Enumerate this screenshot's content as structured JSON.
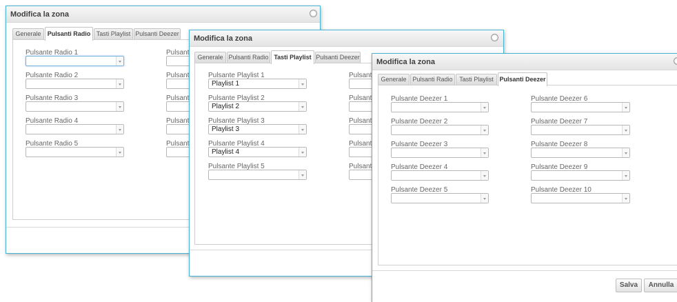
{
  "dialogs": [
    {
      "title": "Modifica la zona",
      "tabs": [
        "Generale",
        "Pulsanti Radio",
        "Tasti Playlist",
        "Pulsanti Deezer"
      ],
      "active_tab": 1,
      "left_fields": [
        {
          "label": "Pulsante Radio 1",
          "value": ""
        },
        {
          "label": "Pulsante Radio 2",
          "value": ""
        },
        {
          "label": "Pulsante Radio 3",
          "value": ""
        },
        {
          "label": "Pulsante Radio 4",
          "value": ""
        },
        {
          "label": "Pulsante Radio 5",
          "value": ""
        }
      ],
      "right_partial_label": "Pulsante"
    },
    {
      "title": "Modifica la zona",
      "tabs": [
        "Generale",
        "Pulsanti Radio",
        "Tasti Playlist",
        "Pulsanti Deezer"
      ],
      "active_tab": 2,
      "left_fields": [
        {
          "label": "Pulsante Playlist 1",
          "value": "Playlist 1"
        },
        {
          "label": "Pulsante Playlist 2",
          "value": "Playlist 2"
        },
        {
          "label": "Pulsante Playlist 3",
          "value": "Playlist 3"
        },
        {
          "label": "Pulsante Playlist 4",
          "value": "Playlist 4"
        },
        {
          "label": "Pulsante Playlist 5",
          "value": ""
        }
      ],
      "right_partial_label": "Pulsante"
    },
    {
      "title": "Modifica la zona",
      "tabs": [
        "Generale",
        "Pulsanti Radio",
        "Tasti Playlist",
        "Pulsanti Deezer"
      ],
      "active_tab": 3,
      "left_fields": [
        {
          "label": "Pulsante Deezer 1",
          "value": ""
        },
        {
          "label": "Pulsante Deezer 2",
          "value": ""
        },
        {
          "label": "Pulsante Deezer 3",
          "value": ""
        },
        {
          "label": "Pulsante Deezer 4",
          "value": ""
        },
        {
          "label": "Pulsante Deezer 5",
          "value": ""
        }
      ],
      "right_fields": [
        {
          "label": "Pulsante Deezer 6",
          "value": ""
        },
        {
          "label": "Pulsante Deezer 7",
          "value": ""
        },
        {
          "label": "Pulsante Deezer 8",
          "value": ""
        },
        {
          "label": "Pulsante Deezer 9",
          "value": ""
        },
        {
          "label": "Pulsante Deezer 10",
          "value": ""
        }
      ],
      "buttons": {
        "save": "Salva",
        "cancel": "Annulla"
      }
    }
  ]
}
